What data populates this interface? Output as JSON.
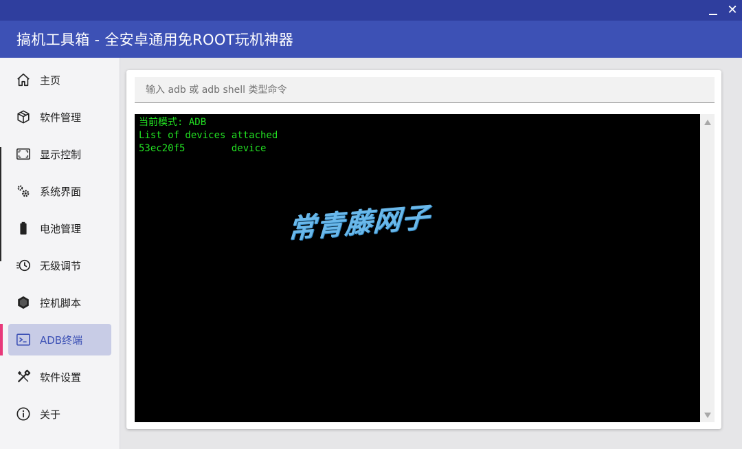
{
  "window": {
    "title": "搞机工具箱 - 全安卓通用免ROOT玩机神器",
    "minimize_icon": "minimize-icon",
    "close_symbol": "✕"
  },
  "sidebar": {
    "items": [
      {
        "label": "主页",
        "icon": "home-icon"
      },
      {
        "label": "软件管理",
        "icon": "package-icon"
      },
      {
        "label": "显示控制",
        "icon": "screen-frame-icon"
      },
      {
        "label": "系统界面",
        "icon": "gears-icon"
      },
      {
        "label": "电池管理",
        "icon": "battery-icon"
      },
      {
        "label": "无级调节",
        "icon": "clock-adjust-icon"
      },
      {
        "label": "控机脚本",
        "icon": "hexagon-icon"
      },
      {
        "label": "ADB终端",
        "icon": "terminal-icon",
        "active": true
      },
      {
        "label": "软件设置",
        "icon": "tools-icon"
      },
      {
        "label": "关于",
        "icon": "info-icon"
      }
    ]
  },
  "main": {
    "command_input": {
      "placeholder": "输入 adb 或 adb shell 类型命令",
      "value": ""
    },
    "terminal": {
      "lines": [
        "当前模式: ADB",
        "List of devices attached",
        "53ec20f5        device"
      ]
    },
    "watermark": "常青藤网子"
  },
  "colors": {
    "title_bar": "#3d51b5",
    "active_accent": "#e8397a",
    "active_bg": "#c8cce6",
    "terminal_bg": "#000000",
    "terminal_text": "#22e022"
  }
}
